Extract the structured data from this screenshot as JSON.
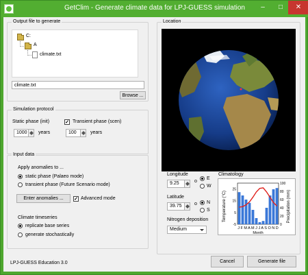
{
  "window": {
    "title": "GetClim - Generate climate data for LPJ-GUESS simulation",
    "controls": {
      "minimize": "–",
      "maximize": "□",
      "close": "✕"
    }
  },
  "output_file": {
    "group_title": "Output file to generate",
    "tree": {
      "root": "C:",
      "folder": "A",
      "file": "climate.txt"
    },
    "filename_value": "climate.txt",
    "browse_label": "Browse ..."
  },
  "simulation_protocol": {
    "group_title": "Simulation protocol",
    "static_label": "Static phase (init)",
    "static_years_value": "1000",
    "static_unit": "years",
    "transient_label": "Transient phase (scen)",
    "transient_checked": true,
    "transient_years_value": "100",
    "transient_unit": "years"
  },
  "input_data": {
    "group_title": "Input data",
    "apply_label": "Apply anomalies to ...",
    "radio_static": "static phase (Palaeo mode)",
    "radio_transient": "transient phase (Future Scenario mode)",
    "enter_anomalies_label": "Enter anomalies ...",
    "advanced_label": "Advanced mode",
    "advanced_checked": true,
    "timeseries_label": "Climate timeseries",
    "radio_replicate": "replicate base series",
    "radio_generate": "generate stochastically"
  },
  "location": {
    "group_title": "Location",
    "longitude_label": "Longitude",
    "longitude_value": "9.25",
    "lon_degree": "o",
    "lon_e": "E",
    "lon_w": "W",
    "latitude_label": "Latitude",
    "latitude_value": "39.75",
    "lat_degree": "o",
    "lat_n": "N",
    "lat_s": "S",
    "nitrogen_label": "Nitrogen deposition",
    "nitrogen_value": "Medium"
  },
  "chart_data": {
    "type": "bar",
    "title": "Climatology",
    "categories": [
      "J",
      "F",
      "M",
      "A",
      "M",
      "J",
      "J",
      "A",
      "S",
      "O",
      "N",
      "D"
    ],
    "category_label_text": "J F M A M J J A S O N D",
    "xlabel": "Month",
    "ylabel_left": "Temperature (°C)",
    "ylabel_right": "Precipitation (mm)",
    "ylim_left": [
      -5,
      30
    ],
    "ylim_right": [
      0,
      100
    ],
    "yticks_left": [
      "-5",
      "5",
      "15",
      "25"
    ],
    "yticks_right": [
      "0",
      "20",
      "40",
      "60",
      "80",
      "100"
    ],
    "series": [
      {
        "name": "Precipitation",
        "kind": "bar",
        "color": "#3a78d8",
        "values": [
          78,
          70,
          60,
          52,
          35,
          15,
          5,
          8,
          40,
          70,
          85,
          88
        ]
      },
      {
        "name": "Temperature",
        "kind": "line",
        "color": "#e0201c",
        "values": [
          9.5,
          10,
          11.5,
          14,
          18,
          22.5,
          25.5,
          26,
          22.5,
          18,
          13.5,
          10.5
        ]
      }
    ]
  },
  "footer": {
    "version": "LPJ-GUESS Education 3.0",
    "cancel_label": "Cancel",
    "generate_label": "Generate file"
  },
  "colors": {
    "titlebar": "#52ae31",
    "close": "#c7362f",
    "ocean": "#1b3f8f",
    "land": "#8c7a3a"
  }
}
